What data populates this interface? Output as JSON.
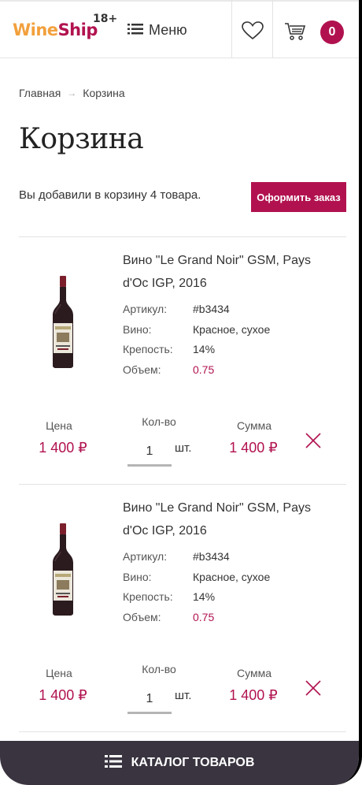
{
  "header": {
    "logo_part1": "Wine",
    "logo_part2": "Ship",
    "age_label": "18+",
    "menu_label": "Меню",
    "cart_count": "0",
    "accent_color": "#b1124f"
  },
  "breadcrumb": {
    "home": "Главная",
    "separator": "→",
    "current": "Корзина"
  },
  "page": {
    "title": "Корзина",
    "added_text": "Вы добавили в корзину 4 товара.",
    "order_button": "Оформить заказ"
  },
  "columns": {
    "price": "Цена",
    "qty": "Кол-во",
    "sum": "Сумма",
    "unit": "шт."
  },
  "items": [
    {
      "name": "Вино \"Le Grand Noir\" GSM, Pays d'Oc IGP, 2016",
      "props": [
        {
          "key": "Артикул:",
          "value": "#b3434"
        },
        {
          "key": "Вино:",
          "value": "Красное, сухое"
        },
        {
          "key": "Крепость:",
          "value": "14%"
        },
        {
          "key": "Объем:",
          "value": "0.75"
        }
      ],
      "price": "1 400 ₽",
      "qty": "1",
      "sum": "1 400 ₽"
    },
    {
      "name": "Вино \"Le Grand Noir\" GSM, Pays d'Oc IGP, 2016",
      "props": [
        {
          "key": "Артикул:",
          "value": "#b3434"
        },
        {
          "key": "Вино:",
          "value": "Красное, сухое"
        },
        {
          "key": "Крепость:",
          "value": "14%"
        },
        {
          "key": "Объем:",
          "value": "0.75"
        }
      ],
      "price": "1 400 ₽",
      "qty": "1",
      "sum": "1 400 ₽"
    }
  ],
  "footer": {
    "catalog_label": "КАТАЛОГ ТОВАРОВ"
  }
}
